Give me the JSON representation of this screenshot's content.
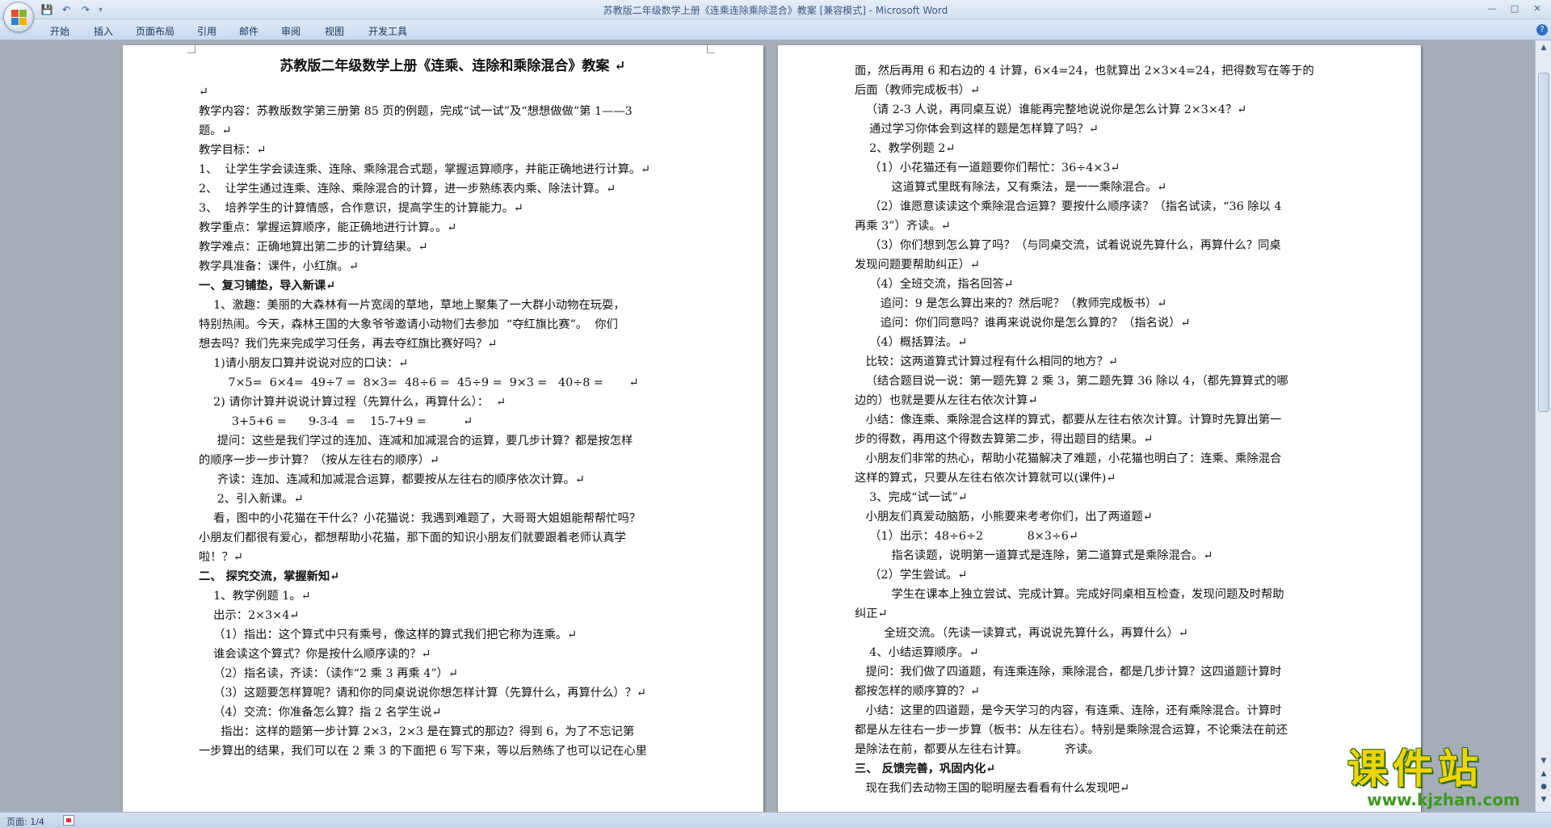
{
  "window": {
    "title": "苏教版二年级数学上册《连乘连除乘除混合》教案 [兼容模式] - Microsoft Word",
    "qat": {
      "save": "💾",
      "undo": "↶",
      "redo": "↷",
      "more": "▾"
    },
    "controls": {
      "minimize": "—",
      "maximize": "□",
      "close": "✕"
    }
  },
  "ribbon": {
    "tabs": [
      "开始",
      "插入",
      "页面布局",
      "引用",
      "邮件",
      "审阅",
      "视图",
      "开发工具"
    ],
    "help": "?"
  },
  "page1": {
    "lines": [
      {
        "t": "苏教版二年级数学上册《连乘、连除和乘除混合》教案 ↵",
        "s": "title"
      },
      {
        "t": "↵"
      },
      {
        "t": "教学内容：苏教版数学第三册第 85 页的例题，完成“试一试”及“想想做做”第 1——3"
      },
      {
        "t": "题。↵"
      },
      {
        "t": "教学目标：↵"
      },
      {
        "t": "1、  让学生学会读连乘、连除、乘除混合式题，掌握运算顺序，并能正确地进行计算。↵"
      },
      {
        "t": "2、  让学生通过连乘、连除、乘除混合的计算，进一步熟练表内乘、除法计算。↵"
      },
      {
        "t": "3、  培养学生的计算情感，合作意识，提高学生的计算能力。↵"
      },
      {
        "t": "教学重点：掌握运算顺序，能正确地进行计算。。↵"
      },
      {
        "t": "教学难点：正确地算出第二步的计算结果。↵"
      },
      {
        "t": "教学具准备：课件，小红旗。↵"
      },
      {
        "t": "一、复习铺垫，导入新课↵",
        "s": "b"
      },
      {
        "t": "    1、激趣：美丽的大森林有一片宽阔的草地，草地上聚集了一大群小动物在玩耍，"
      },
      {
        "t": "特别热闹。今天，森林王国的大象爷爷邀请小动物们去参加  “夺红旗比赛”。  你们"
      },
      {
        "t": "想去吗？我们先来完成学习任务，再去夺红旗比赛好吗？↵"
      },
      {
        "t": "    1)请小朋友口算并说说对应的口诀：↵"
      },
      {
        "t": "        7×5=  6×4=  49÷7 =  8×3=  48÷6 =  45÷9 =  9×3 =   40÷8 =       ↵"
      },
      {
        "t": "    2) 请你计算并说说计算过程（先算什么，再算什么）：  ↵"
      },
      {
        "t": "         3+5+6 =      9-3-4  =    15-7+9 =          ↵"
      },
      {
        "t": "     提问：这些是我们学过的连加、连减和加减混合的运算，要几步计算？都是按怎样"
      },
      {
        "t": "的顺序一步一步计算？（按从左往右的顺序）↵"
      },
      {
        "t": "     齐读：连加、连减和加减混合运算，都要按从左往右的顺序依次计算。↵"
      },
      {
        "t": "     2、引入新课。↵"
      },
      {
        "t": "    看，图中的小花猫在干什么？小花猫说：我遇到难题了，大哥哥大姐姐能帮帮忙吗？"
      },
      {
        "t": "小朋友们都很有爱心，都想帮助小花猫，那下面的知识小朋友们就要跟着老师认真学"
      },
      {
        "t": "啦！？↵"
      },
      {
        "t": "二、 探究交流，掌握新知↵",
        "s": "b"
      },
      {
        "t": "    1、教学例题 1。↵"
      },
      {
        "t": "    出示：2×3×4↵"
      },
      {
        "t": "    （1）指出：这个算式中只有乘号，像这样的算式我们把它称为连乘。↵"
      },
      {
        "t": "    谁会读这个算式？你是按什么顺序读的？↵"
      },
      {
        "t": "    （2）指名读，齐读：（读作“2 乘 3 再乘 4”）↵"
      },
      {
        "t": "    （3）这题要怎样算呢？请和你的同桌说说你想怎样计算（先算什么，再算什么）？↵"
      },
      {
        "t": "    （4）交流：你准备怎么算？指 2 名学生说↵"
      },
      {
        "t": "      指出：这样的题第一步计算 2×3，2×3 是在算式的那边？得到 6，为了不忘记第"
      },
      {
        "t": "一步算出的结果，我们可以在 2 乘 3 的下面把 6 写下来，等以后熟练了也可以记在心里"
      }
    ]
  },
  "page2": {
    "lines": [
      {
        "t": "面，然后再用 6 和右边的 4 计算，6×4=24，也就算出 2×3×4=24，把得数写在等于的"
      },
      {
        "t": "后面（教师完成板书）↵"
      },
      {
        "t": "   （请 2-3 人说，再同桌互说）谁能再完整地说说你是怎么计算 2×3×4？↵"
      },
      {
        "t": "    通过学习你体会到这样的题是怎样算了吗？↵"
      },
      {
        "t": "    2、教学例题 2↵"
      },
      {
        "t": "    （1）小花猫还有一道题要你们帮忙：36÷4×3↵"
      },
      {
        "t": "          这道算式里既有除法，又有乘法，是一一乘除混合。↵"
      },
      {
        "t": "    （2）谁愿意读读这个乘除混合运算？要按什么顺序读？（指名试读，“36 除以 4"
      },
      {
        "t": "再乘 3”）齐读。↵"
      },
      {
        "t": "    （3）你们想到怎么算了吗？（与同桌交流，试着说说先算什么，再算什么？同桌"
      },
      {
        "t": "发现问题要帮助纠正）↵"
      },
      {
        "t": "    （4）全班交流，指名回答↵"
      },
      {
        "t": "       追问：9 是怎么算出来的？然后呢？（教师完成板书）↵"
      },
      {
        "t": "       追问：你们同意吗？谁再来说说你是怎么算的？（指名说）↵"
      },
      {
        "t": "    （4）概括算法。↵"
      },
      {
        "t": "   比较：这两道算式计算过程有什么相同的地方？↵"
      },
      {
        "t": "   （结合题目说一说：第一题先算 2 乘 3，第二题先算 36 除以 4，（都先算算式的哪"
      },
      {
        "t": "边的）也就是要从左往右依次计算↵"
      },
      {
        "t": "   小结：像连乘、乘除混合这样的算式，都要从左往右依次计算。计算时先算出第一"
      },
      {
        "t": "步的得数，再用这个得数去算第二步，得出题目的结果。↵"
      },
      {
        "t": "   小朋友们非常的热心，帮助小花猫解决了难题，小花猫也明白了：连乘、乘除混合"
      },
      {
        "t": "这样的算式，只要从左往右依次计算就可以(课件)↵"
      },
      {
        "t": "    3、完成“试一试”↵"
      },
      {
        "t": "   小朋友们真爱动脑筋，小熊要来考考你们，出了两道题↵"
      },
      {
        "t": "    （1）出示：48÷6÷2            8×3÷6↵"
      },
      {
        "t": "          指名读题，说明第一道算式是连除，第二道算式是乘除混合。↵"
      },
      {
        "t": "    （2）学生尝试。↵"
      },
      {
        "t": "          学生在课本上独立尝试、完成计算。完成好同桌相互检查，发现问题及时帮助"
      },
      {
        "t": "纠正↵"
      },
      {
        "t": "        全班交流。（先读一读算式，再说说先算什么，再算什么）↵"
      },
      {
        "t": "    4、小结运算顺序。↵"
      },
      {
        "t": "   提问：我们做了四道题，有连乘连除，乘除混合，都是几步计算？这四道题计算时"
      },
      {
        "t": "都按怎样的顺序算的？↵"
      },
      {
        "t": "   小结：这里的四道题，是今天学习的内容，有连乘、连除，还有乘除混合。计算时"
      },
      {
        "t": "都是从左往右一步一步算（板书：从左往右）。特别是乘除混合运算，不论乘法在前还"
      },
      {
        "t": "是除法在前，都要从左往右计算。          齐读。"
      },
      {
        "t": "三、 反馈完善，巩固内化↵",
        "s": "b"
      },
      {
        "t": "   现在我们去动物王国的聪明屋去看看有什么发现吧↵"
      }
    ]
  },
  "statusbar": {
    "page": "页面: 1/4"
  },
  "watermark": {
    "brand": "课件站",
    "url": "www.kjzhan.com"
  },
  "colors": {
    "watermark_fill": "#f2d400",
    "watermark_outline": "#2a6a12",
    "url": "#3c9a1f",
    "ribbon": "#dfe9f5"
  }
}
